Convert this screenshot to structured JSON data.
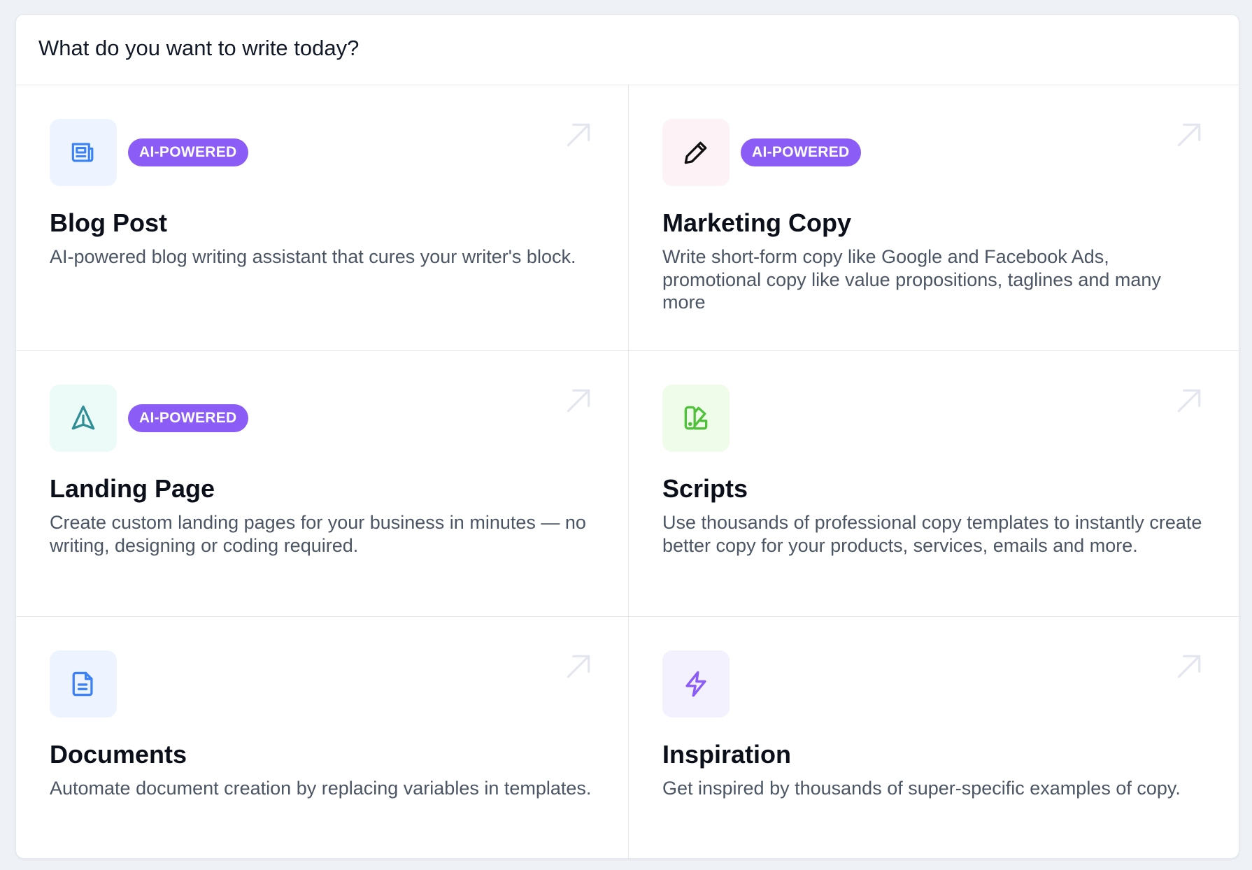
{
  "header": {
    "title": "What do you want to write today?"
  },
  "cards": [
    {
      "title": "Blog Post",
      "badge": "AI-POWERED",
      "description": "AI-powered blog writing assistant that cures your writer's block.",
      "icon": "newspaper-icon",
      "tile_color": "#eef4ff",
      "icon_color": "#3b82f6"
    },
    {
      "title": "Marketing Copy",
      "badge": "AI-POWERED",
      "description": "Write short-form copy like Google and Facebook Ads, promotional copy like value propositions, taglines and many more",
      "icon": "pencil-icon",
      "tile_color": "#fdf2f6",
      "icon_color": "#111111"
    },
    {
      "title": "Landing Page",
      "badge": "AI-POWERED",
      "description": "Create custom landing pages for your business in minutes — no writing, designing or coding required.",
      "icon": "send-icon",
      "tile_color": "#ecfaf8",
      "icon_color": "#2f8f95"
    },
    {
      "title": "Scripts",
      "badge": "",
      "description": "Use thousands of professional copy templates to instantly create better copy for your products, services, emails and more.",
      "icon": "swatch-icon",
      "tile_color": "#effcea",
      "icon_color": "#4fc13b"
    },
    {
      "title": "Documents",
      "badge": "",
      "description": "Automate document creation by replacing variables in templates.",
      "icon": "document-icon",
      "tile_color": "#eef4ff",
      "icon_color": "#3b82f6"
    },
    {
      "title": "Inspiration",
      "badge": "",
      "description": "Get inspired by thousands of super-specific examples of copy.",
      "icon": "lightning-icon",
      "tile_color": "#f4f1fe",
      "icon_color": "#8b5cf6"
    }
  ],
  "colors": {
    "badge_bg": "#8b5cf6",
    "arrow": "#e3e6ee",
    "divider": "#e5e7eb"
  }
}
